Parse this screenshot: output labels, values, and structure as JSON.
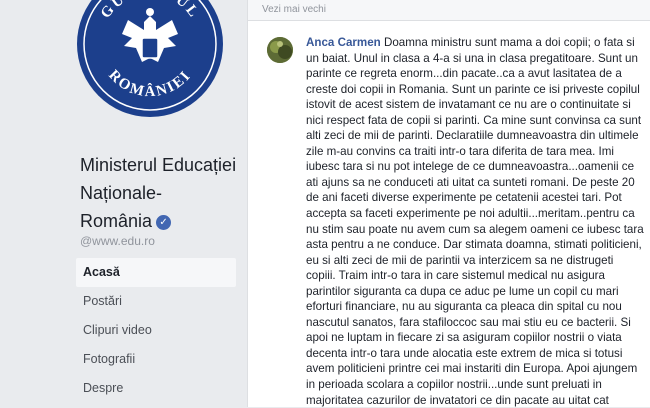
{
  "page": {
    "name_lines": [
      "Ministerul Educației",
      "Naționale-",
      "România"
    ],
    "handle": "@www.edu.ro",
    "logo_text": {
      "top": "GUVERNUL",
      "bottom": "ROMÂNIEI"
    }
  },
  "nav": {
    "items": [
      {
        "label": "Acasă",
        "active": true
      },
      {
        "label": "Postări",
        "active": false
      },
      {
        "label": "Clipuri video",
        "active": false
      },
      {
        "label": "Fotografii",
        "active": false
      },
      {
        "label": "Despre",
        "active": false
      }
    ]
  },
  "feed": {
    "top_text": "Vezi mai vechi",
    "comment": {
      "author": "Anca Carmen",
      "text": "Doamna ministru sunt mama a doi copii; o fata si un baiat. Unul in clasa a 4-a si una in clasa pregatitoare. Sunt un parinte ce regreta enorm...din pacate..ca a avut lasitatea de a creste doi copii in Romania. Sunt un parinte ce isi priveste copilul istovit de acest sistem de invatamant ce nu are o continuitate si nici respect fata de copii si parinti. Ca mine sunt convinsa ca sunt alti zeci de mii de parinti. Declaratiile dumneavoastra din ultimele zile m-au convins ca traiti intr-o tara diferita de tara mea. Imi iubesc tara si nu pot intelege de ce dumneavoastra...oamenii ce ati ajuns sa ne conduceti ati uitat ca sunteti romani. De peste 20 de ani faceti diverse experimente pe cetatenii acestei tari. Pot accepta sa faceti experimente pe noi adultii...meritam..pentru ca nu stim sau poate nu avem cum sa alegem oameni ce iubesc tara asta pentru a ne conduce. Dar stimata doamna, stimati politicieni, eu si alti zeci de mii de parintii va interzicem sa ne distrugeti copiii. Traim intr-o tara in care sistemul medical nu asigura parintilor siguranta ca dupa ce aduc pe lume un copil cu mari eforturi financiare, nu au siguranta ca pleaca din spital cu nou nascutul sanatos, fara stafiloccoc sau mai stiu eu ce bacterii. Si apoi ne luptam in fiecare zi sa asiguram copiilor nostrii o viata decenta intr-o tara unde alocatia este extrem de mica si totusi avem politicieni printre cei mai instariti din Europa. Apoi ajungem in perioada scolara a copiilor nostrii...unde sunt preluati in majoritatea cazurilor de invatatori ce din pacate au uitat cat"
    }
  },
  "colors": {
    "link": "#385898",
    "page_bg": "#e9ebee",
    "logo_blue": "#1c3f8c",
    "verified": "#4267b2"
  }
}
